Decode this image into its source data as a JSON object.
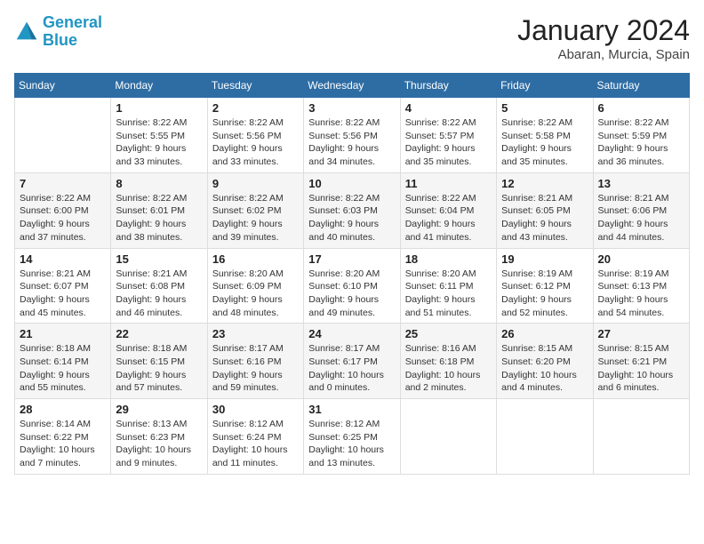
{
  "header": {
    "logo_line1": "General",
    "logo_line2": "Blue",
    "month": "January 2024",
    "location": "Abaran, Murcia, Spain"
  },
  "weekdays": [
    "Sunday",
    "Monday",
    "Tuesday",
    "Wednesday",
    "Thursday",
    "Friday",
    "Saturday"
  ],
  "weeks": [
    [
      {
        "day": "",
        "sunrise": "",
        "sunset": "",
        "daylight": ""
      },
      {
        "day": "1",
        "sunrise": "Sunrise: 8:22 AM",
        "sunset": "Sunset: 5:55 PM",
        "daylight": "Daylight: 9 hours and 33 minutes."
      },
      {
        "day": "2",
        "sunrise": "Sunrise: 8:22 AM",
        "sunset": "Sunset: 5:56 PM",
        "daylight": "Daylight: 9 hours and 33 minutes."
      },
      {
        "day": "3",
        "sunrise": "Sunrise: 8:22 AM",
        "sunset": "Sunset: 5:56 PM",
        "daylight": "Daylight: 9 hours and 34 minutes."
      },
      {
        "day": "4",
        "sunrise": "Sunrise: 8:22 AM",
        "sunset": "Sunset: 5:57 PM",
        "daylight": "Daylight: 9 hours and 35 minutes."
      },
      {
        "day": "5",
        "sunrise": "Sunrise: 8:22 AM",
        "sunset": "Sunset: 5:58 PM",
        "daylight": "Daylight: 9 hours and 35 minutes."
      },
      {
        "day": "6",
        "sunrise": "Sunrise: 8:22 AM",
        "sunset": "Sunset: 5:59 PM",
        "daylight": "Daylight: 9 hours and 36 minutes."
      }
    ],
    [
      {
        "day": "7",
        "sunrise": "Sunrise: 8:22 AM",
        "sunset": "Sunset: 6:00 PM",
        "daylight": "Daylight: 9 hours and 37 minutes."
      },
      {
        "day": "8",
        "sunrise": "Sunrise: 8:22 AM",
        "sunset": "Sunset: 6:01 PM",
        "daylight": "Daylight: 9 hours and 38 minutes."
      },
      {
        "day": "9",
        "sunrise": "Sunrise: 8:22 AM",
        "sunset": "Sunset: 6:02 PM",
        "daylight": "Daylight: 9 hours and 39 minutes."
      },
      {
        "day": "10",
        "sunrise": "Sunrise: 8:22 AM",
        "sunset": "Sunset: 6:03 PM",
        "daylight": "Daylight: 9 hours and 40 minutes."
      },
      {
        "day": "11",
        "sunrise": "Sunrise: 8:22 AM",
        "sunset": "Sunset: 6:04 PM",
        "daylight": "Daylight: 9 hours and 41 minutes."
      },
      {
        "day": "12",
        "sunrise": "Sunrise: 8:21 AM",
        "sunset": "Sunset: 6:05 PM",
        "daylight": "Daylight: 9 hours and 43 minutes."
      },
      {
        "day": "13",
        "sunrise": "Sunrise: 8:21 AM",
        "sunset": "Sunset: 6:06 PM",
        "daylight": "Daylight: 9 hours and 44 minutes."
      }
    ],
    [
      {
        "day": "14",
        "sunrise": "Sunrise: 8:21 AM",
        "sunset": "Sunset: 6:07 PM",
        "daylight": "Daylight: 9 hours and 45 minutes."
      },
      {
        "day": "15",
        "sunrise": "Sunrise: 8:21 AM",
        "sunset": "Sunset: 6:08 PM",
        "daylight": "Daylight: 9 hours and 46 minutes."
      },
      {
        "day": "16",
        "sunrise": "Sunrise: 8:20 AM",
        "sunset": "Sunset: 6:09 PM",
        "daylight": "Daylight: 9 hours and 48 minutes."
      },
      {
        "day": "17",
        "sunrise": "Sunrise: 8:20 AM",
        "sunset": "Sunset: 6:10 PM",
        "daylight": "Daylight: 9 hours and 49 minutes."
      },
      {
        "day": "18",
        "sunrise": "Sunrise: 8:20 AM",
        "sunset": "Sunset: 6:11 PM",
        "daylight": "Daylight: 9 hours and 51 minutes."
      },
      {
        "day": "19",
        "sunrise": "Sunrise: 8:19 AM",
        "sunset": "Sunset: 6:12 PM",
        "daylight": "Daylight: 9 hours and 52 minutes."
      },
      {
        "day": "20",
        "sunrise": "Sunrise: 8:19 AM",
        "sunset": "Sunset: 6:13 PM",
        "daylight": "Daylight: 9 hours and 54 minutes."
      }
    ],
    [
      {
        "day": "21",
        "sunrise": "Sunrise: 8:18 AM",
        "sunset": "Sunset: 6:14 PM",
        "daylight": "Daylight: 9 hours and 55 minutes."
      },
      {
        "day": "22",
        "sunrise": "Sunrise: 8:18 AM",
        "sunset": "Sunset: 6:15 PM",
        "daylight": "Daylight: 9 hours and 57 minutes."
      },
      {
        "day": "23",
        "sunrise": "Sunrise: 8:17 AM",
        "sunset": "Sunset: 6:16 PM",
        "daylight": "Daylight: 9 hours and 59 minutes."
      },
      {
        "day": "24",
        "sunrise": "Sunrise: 8:17 AM",
        "sunset": "Sunset: 6:17 PM",
        "daylight": "Daylight: 10 hours and 0 minutes."
      },
      {
        "day": "25",
        "sunrise": "Sunrise: 8:16 AM",
        "sunset": "Sunset: 6:18 PM",
        "daylight": "Daylight: 10 hours and 2 minutes."
      },
      {
        "day": "26",
        "sunrise": "Sunrise: 8:15 AM",
        "sunset": "Sunset: 6:20 PM",
        "daylight": "Daylight: 10 hours and 4 minutes."
      },
      {
        "day": "27",
        "sunrise": "Sunrise: 8:15 AM",
        "sunset": "Sunset: 6:21 PM",
        "daylight": "Daylight: 10 hours and 6 minutes."
      }
    ],
    [
      {
        "day": "28",
        "sunrise": "Sunrise: 8:14 AM",
        "sunset": "Sunset: 6:22 PM",
        "daylight": "Daylight: 10 hours and 7 minutes."
      },
      {
        "day": "29",
        "sunrise": "Sunrise: 8:13 AM",
        "sunset": "Sunset: 6:23 PM",
        "daylight": "Daylight: 10 hours and 9 minutes."
      },
      {
        "day": "30",
        "sunrise": "Sunrise: 8:12 AM",
        "sunset": "Sunset: 6:24 PM",
        "daylight": "Daylight: 10 hours and 11 minutes."
      },
      {
        "day": "31",
        "sunrise": "Sunrise: 8:12 AM",
        "sunset": "Sunset: 6:25 PM",
        "daylight": "Daylight: 10 hours and 13 minutes."
      },
      {
        "day": "",
        "sunrise": "",
        "sunset": "",
        "daylight": ""
      },
      {
        "day": "",
        "sunrise": "",
        "sunset": "",
        "daylight": ""
      },
      {
        "day": "",
        "sunrise": "",
        "sunset": "",
        "daylight": ""
      }
    ]
  ]
}
